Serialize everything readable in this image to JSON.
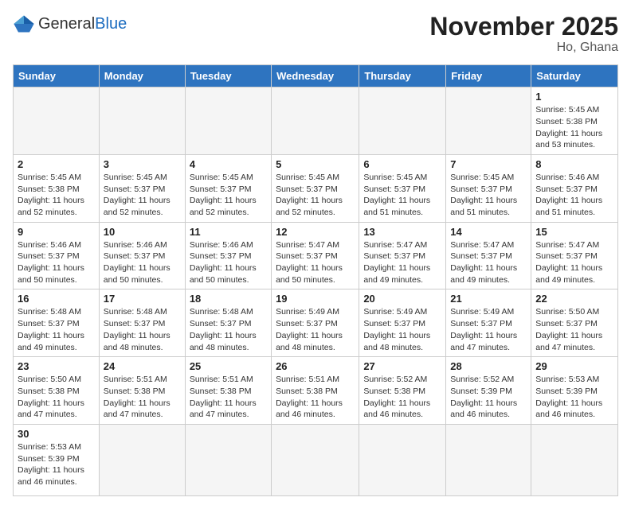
{
  "logo": {
    "general": "General",
    "blue": "Blue"
  },
  "title": "November 2025",
  "location": "Ho, Ghana",
  "days_of_week": [
    "Sunday",
    "Monday",
    "Tuesday",
    "Wednesday",
    "Thursday",
    "Friday",
    "Saturday"
  ],
  "weeks": [
    [
      {
        "day": "",
        "info": ""
      },
      {
        "day": "",
        "info": ""
      },
      {
        "day": "",
        "info": ""
      },
      {
        "day": "",
        "info": ""
      },
      {
        "day": "",
        "info": ""
      },
      {
        "day": "",
        "info": ""
      },
      {
        "day": "1",
        "info": "Sunrise: 5:45 AM\nSunset: 5:38 PM\nDaylight: 11 hours\nand 53 minutes."
      }
    ],
    [
      {
        "day": "2",
        "info": "Sunrise: 5:45 AM\nSunset: 5:38 PM\nDaylight: 11 hours\nand 52 minutes."
      },
      {
        "day": "3",
        "info": "Sunrise: 5:45 AM\nSunset: 5:37 PM\nDaylight: 11 hours\nand 52 minutes."
      },
      {
        "day": "4",
        "info": "Sunrise: 5:45 AM\nSunset: 5:37 PM\nDaylight: 11 hours\nand 52 minutes."
      },
      {
        "day": "5",
        "info": "Sunrise: 5:45 AM\nSunset: 5:37 PM\nDaylight: 11 hours\nand 52 minutes."
      },
      {
        "day": "6",
        "info": "Sunrise: 5:45 AM\nSunset: 5:37 PM\nDaylight: 11 hours\nand 51 minutes."
      },
      {
        "day": "7",
        "info": "Sunrise: 5:45 AM\nSunset: 5:37 PM\nDaylight: 11 hours\nand 51 minutes."
      },
      {
        "day": "8",
        "info": "Sunrise: 5:46 AM\nSunset: 5:37 PM\nDaylight: 11 hours\nand 51 minutes."
      }
    ],
    [
      {
        "day": "9",
        "info": "Sunrise: 5:46 AM\nSunset: 5:37 PM\nDaylight: 11 hours\nand 50 minutes."
      },
      {
        "day": "10",
        "info": "Sunrise: 5:46 AM\nSunset: 5:37 PM\nDaylight: 11 hours\nand 50 minutes."
      },
      {
        "day": "11",
        "info": "Sunrise: 5:46 AM\nSunset: 5:37 PM\nDaylight: 11 hours\nand 50 minutes."
      },
      {
        "day": "12",
        "info": "Sunrise: 5:47 AM\nSunset: 5:37 PM\nDaylight: 11 hours\nand 50 minutes."
      },
      {
        "day": "13",
        "info": "Sunrise: 5:47 AM\nSunset: 5:37 PM\nDaylight: 11 hours\nand 49 minutes."
      },
      {
        "day": "14",
        "info": "Sunrise: 5:47 AM\nSunset: 5:37 PM\nDaylight: 11 hours\nand 49 minutes."
      },
      {
        "day": "15",
        "info": "Sunrise: 5:47 AM\nSunset: 5:37 PM\nDaylight: 11 hours\nand 49 minutes."
      }
    ],
    [
      {
        "day": "16",
        "info": "Sunrise: 5:48 AM\nSunset: 5:37 PM\nDaylight: 11 hours\nand 49 minutes."
      },
      {
        "day": "17",
        "info": "Sunrise: 5:48 AM\nSunset: 5:37 PM\nDaylight: 11 hours\nand 48 minutes."
      },
      {
        "day": "18",
        "info": "Sunrise: 5:48 AM\nSunset: 5:37 PM\nDaylight: 11 hours\nand 48 minutes."
      },
      {
        "day": "19",
        "info": "Sunrise: 5:49 AM\nSunset: 5:37 PM\nDaylight: 11 hours\nand 48 minutes."
      },
      {
        "day": "20",
        "info": "Sunrise: 5:49 AM\nSunset: 5:37 PM\nDaylight: 11 hours\nand 48 minutes."
      },
      {
        "day": "21",
        "info": "Sunrise: 5:49 AM\nSunset: 5:37 PM\nDaylight: 11 hours\nand 47 minutes."
      },
      {
        "day": "22",
        "info": "Sunrise: 5:50 AM\nSunset: 5:37 PM\nDaylight: 11 hours\nand 47 minutes."
      }
    ],
    [
      {
        "day": "23",
        "info": "Sunrise: 5:50 AM\nSunset: 5:38 PM\nDaylight: 11 hours\nand 47 minutes."
      },
      {
        "day": "24",
        "info": "Sunrise: 5:51 AM\nSunset: 5:38 PM\nDaylight: 11 hours\nand 47 minutes."
      },
      {
        "day": "25",
        "info": "Sunrise: 5:51 AM\nSunset: 5:38 PM\nDaylight: 11 hours\nand 47 minutes."
      },
      {
        "day": "26",
        "info": "Sunrise: 5:51 AM\nSunset: 5:38 PM\nDaylight: 11 hours\nand 46 minutes."
      },
      {
        "day": "27",
        "info": "Sunrise: 5:52 AM\nSunset: 5:38 PM\nDaylight: 11 hours\nand 46 minutes."
      },
      {
        "day": "28",
        "info": "Sunrise: 5:52 AM\nSunset: 5:39 PM\nDaylight: 11 hours\nand 46 minutes."
      },
      {
        "day": "29",
        "info": "Sunrise: 5:53 AM\nSunset: 5:39 PM\nDaylight: 11 hours\nand 46 minutes."
      }
    ],
    [
      {
        "day": "30",
        "info": "Sunrise: 5:53 AM\nSunset: 5:39 PM\nDaylight: 11 hours\nand 46 minutes."
      },
      {
        "day": "",
        "info": ""
      },
      {
        "day": "",
        "info": ""
      },
      {
        "day": "",
        "info": ""
      },
      {
        "day": "",
        "info": ""
      },
      {
        "day": "",
        "info": ""
      },
      {
        "day": "",
        "info": ""
      }
    ]
  ]
}
